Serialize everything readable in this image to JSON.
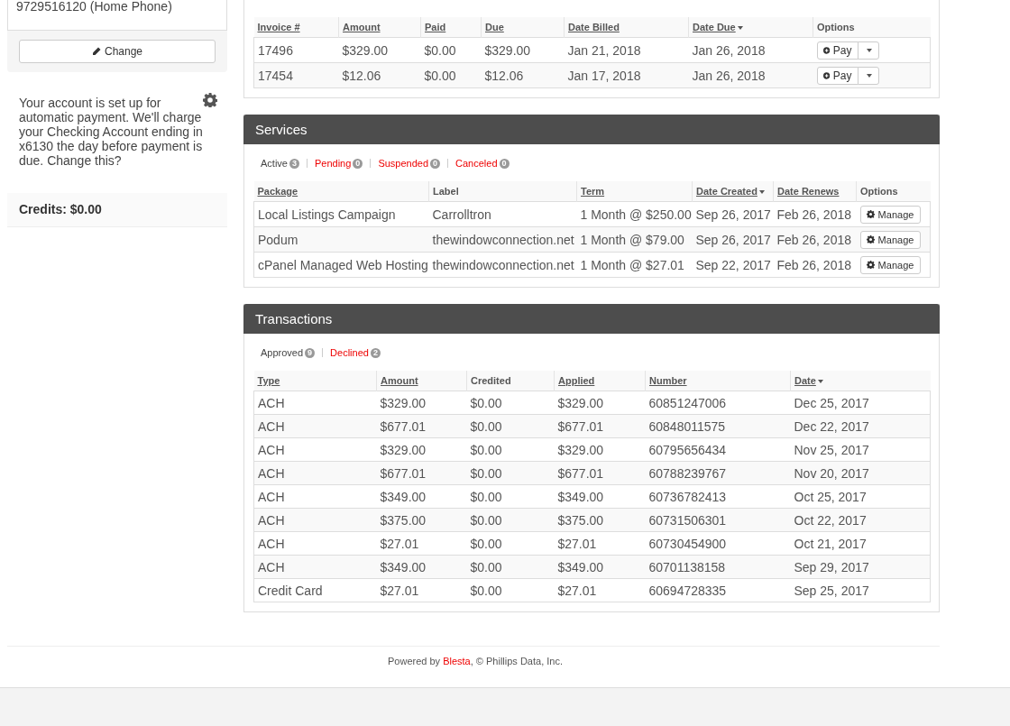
{
  "sidebar": {
    "contact_lines": [
      "9729516120 (Home Phone)"
    ],
    "change_button": "Change",
    "autopay_text": "Your account is set up for automatic payment. We'll charge your Checking Account ending in x6130 the day before payment is due. Change this?",
    "credits": "Credits: $0.00"
  },
  "panels": [
    {
      "table": {
        "columns": [
          {
            "label": "Invoice #",
            "sortable": true,
            "sorted": false
          },
          {
            "label": "Amount",
            "sortable": true,
            "sorted": false
          },
          {
            "label": "Paid",
            "sortable": true,
            "sorted": false
          },
          {
            "label": "Due",
            "sortable": true,
            "sorted": false
          },
          {
            "label": "Date Billed",
            "sortable": true,
            "sorted": false
          },
          {
            "label": "Date Due",
            "sortable": true,
            "sorted": true
          },
          {
            "label": "Options",
            "sortable": false,
            "sorted": false
          }
        ],
        "rows": [
          {
            "cells": [
              "17496",
              "$329.00",
              "$0.00",
              "$329.00",
              "Jan 21, 2018",
              "Jan 26, 2018"
            ],
            "action": {
              "kind": "pay",
              "label": "Pay"
            }
          },
          {
            "cells": [
              "17454",
              "$12.06",
              "$0.00",
              "$12.06",
              "Jan 17, 2018",
              "Jan 26, 2018"
            ],
            "action": {
              "kind": "pay",
              "label": "Pay"
            }
          }
        ]
      }
    },
    {
      "title": "Services",
      "filters": [
        {
          "label": "Active",
          "count": "3",
          "selected": true
        },
        {
          "label": "Pending",
          "count": "0",
          "selected": false
        },
        {
          "label": "Suspended",
          "count": "0",
          "selected": false
        },
        {
          "label": "Canceled",
          "count": "0",
          "selected": false
        }
      ],
      "table": {
        "columns": [
          {
            "label": "Package",
            "sortable": true,
            "sorted": false
          },
          {
            "label": "Label",
            "sortable": false,
            "sorted": false
          },
          {
            "label": "Term",
            "sortable": true,
            "sorted": false
          },
          {
            "label": "Date Created",
            "sortable": true,
            "sorted": true
          },
          {
            "label": "Date Renews",
            "sortable": true,
            "sorted": false
          },
          {
            "label": "Options",
            "sortable": false,
            "sorted": false
          }
        ],
        "rows": [
          {
            "cells": [
              "Local Listings Campaign",
              "Carrolltron",
              "1 Month @ $250.00",
              "Sep 26, 2017",
              "Feb 26, 2018"
            ],
            "action": {
              "kind": "manage",
              "label": "Manage"
            }
          },
          {
            "cells": [
              "Podum",
              "thewindowconnection.net",
              "1 Month @ $79.00",
              "Sep 26, 2017",
              "Feb 26, 2018"
            ],
            "action": {
              "kind": "manage",
              "label": "Manage"
            }
          },
          {
            "cells": [
              "cPanel Managed Web Hosting",
              "thewindowconnection.net",
              "1 Month @ $27.01",
              "Sep 22, 2017",
              "Feb 26, 2018"
            ],
            "action": {
              "kind": "manage",
              "label": "Manage"
            }
          }
        ]
      }
    },
    {
      "title": "Transactions",
      "filters": [
        {
          "label": "Approved",
          "count": "9",
          "selected": true
        },
        {
          "label": "Declined",
          "count": "2",
          "selected": false
        }
      ],
      "table": {
        "columns": [
          {
            "label": "Type",
            "sortable": true,
            "sorted": false
          },
          {
            "label": "Amount",
            "sortable": true,
            "sorted": false
          },
          {
            "label": "Credited",
            "sortable": false,
            "sorted": false
          },
          {
            "label": "Applied",
            "sortable": true,
            "sorted": false
          },
          {
            "label": "Number",
            "sortable": true,
            "sorted": false
          },
          {
            "label": "Date",
            "sortable": true,
            "sorted": true
          }
        ],
        "rows": [
          {
            "cells": [
              "ACH",
              "$329.00",
              "$0.00",
              "$329.00",
              "60851247006",
              "Dec 25, 2017"
            ]
          },
          {
            "cells": [
              "ACH",
              "$677.01",
              "$0.00",
              "$677.01",
              "60848011575",
              "Dec 22, 2017"
            ]
          },
          {
            "cells": [
              "ACH",
              "$329.00",
              "$0.00",
              "$329.00",
              "60795656434",
              "Nov 25, 2017"
            ]
          },
          {
            "cells": [
              "ACH",
              "$677.01",
              "$0.00",
              "$677.01",
              "60788239767",
              "Nov 20, 2017"
            ]
          },
          {
            "cells": [
              "ACH",
              "$349.00",
              "$0.00",
              "$349.00",
              "60736782413",
              "Oct 25, 2017"
            ]
          },
          {
            "cells": [
              "ACH",
              "$375.00",
              "$0.00",
              "$375.00",
              "60731506301",
              "Oct 22, 2017"
            ]
          },
          {
            "cells": [
              "ACH",
              "$27.01",
              "$0.00",
              "$27.01",
              "60730454900",
              "Oct 21, 2017"
            ]
          },
          {
            "cells": [
              "ACH",
              "$349.00",
              "$0.00",
              "$349.00",
              "60701138158",
              "Sep 29, 2017"
            ]
          },
          {
            "cells": [
              "Credit Card",
              "$27.01",
              "$0.00",
              "$27.01",
              "60694728335",
              "Sep 25, 2017"
            ]
          }
        ]
      }
    }
  ],
  "footer": {
    "text": "Powered by ",
    "link": "Blesta",
    "rest": ", © Phillips Data, Inc."
  }
}
